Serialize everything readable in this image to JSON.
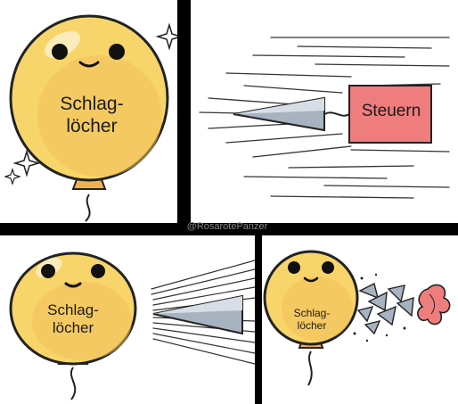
{
  "panels": [
    {
      "balloon_label": "Schlag-\nlöcher"
    },
    {
      "flag_label": "Steuern"
    },
    {
      "balloon_label": "Schlag-\nlöcher"
    },
    {
      "balloon_label": "Schlag-\nlöcher"
    }
  ],
  "watermark": "@RosarotePanzer",
  "colors": {
    "balloon": "#f8d56a",
    "balloon_shadow": "#f0b24e",
    "flag": "#ef7d7d",
    "dart": "#a7b3c0",
    "divider": "#000000"
  }
}
